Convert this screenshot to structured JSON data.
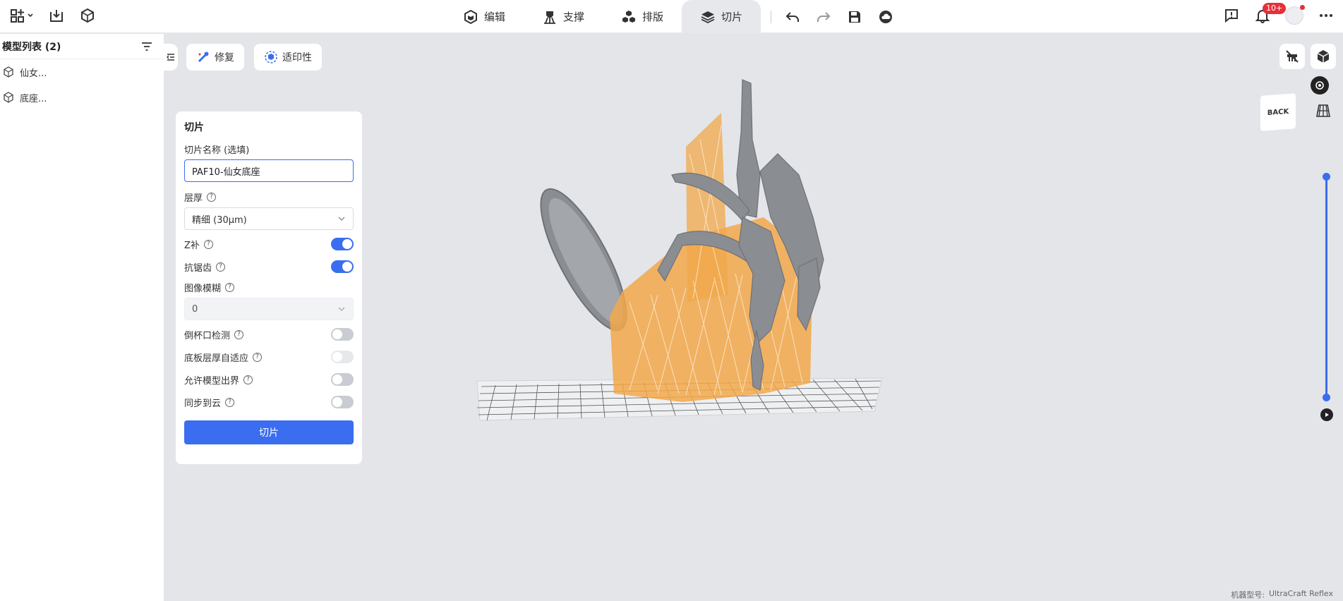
{
  "header": {
    "tabs": [
      {
        "label": "编辑",
        "icon": "edit-cube-icon"
      },
      {
        "label": "支撑",
        "icon": "support-icon"
      },
      {
        "label": "排版",
        "icon": "layout-icon"
      },
      {
        "label": "切片",
        "icon": "layers-icon",
        "active": true
      }
    ],
    "notification_count": "10+"
  },
  "model_list": {
    "title": "模型列表 (2)",
    "items": [
      {
        "label": "仙女..."
      },
      {
        "label": "底座..."
      }
    ]
  },
  "viewport_buttons": {
    "repair": "修复",
    "printability": "适印性"
  },
  "slice_panel": {
    "title": "切片",
    "name_label": "切片名称 (选填)",
    "name_value": "PAF10-仙女底座",
    "layer_label": "层厚",
    "layer_value": "精细 (30μm)",
    "z_comp_label": "Z补",
    "z_comp_on": true,
    "antialias_label": "抗锯齿",
    "antialias_on": true,
    "blur_label": "图像模糊",
    "blur_value": "0",
    "cup_label": "倒杯口检测",
    "cup_on": false,
    "base_label": "底板层厚自适应",
    "base_on": false,
    "outbound_label": "允许模型出界",
    "outbound_on": false,
    "cloud_label": "同步到云",
    "cloud_on": false,
    "button": "切片"
  },
  "view_cube": {
    "face": "BACK"
  },
  "machine": {
    "label": "机器型号:",
    "value": "UltraCraft Reflex"
  },
  "colors": {
    "accent": "#3a6df0",
    "support": "#f2a84a",
    "model": "#8a8d92"
  }
}
